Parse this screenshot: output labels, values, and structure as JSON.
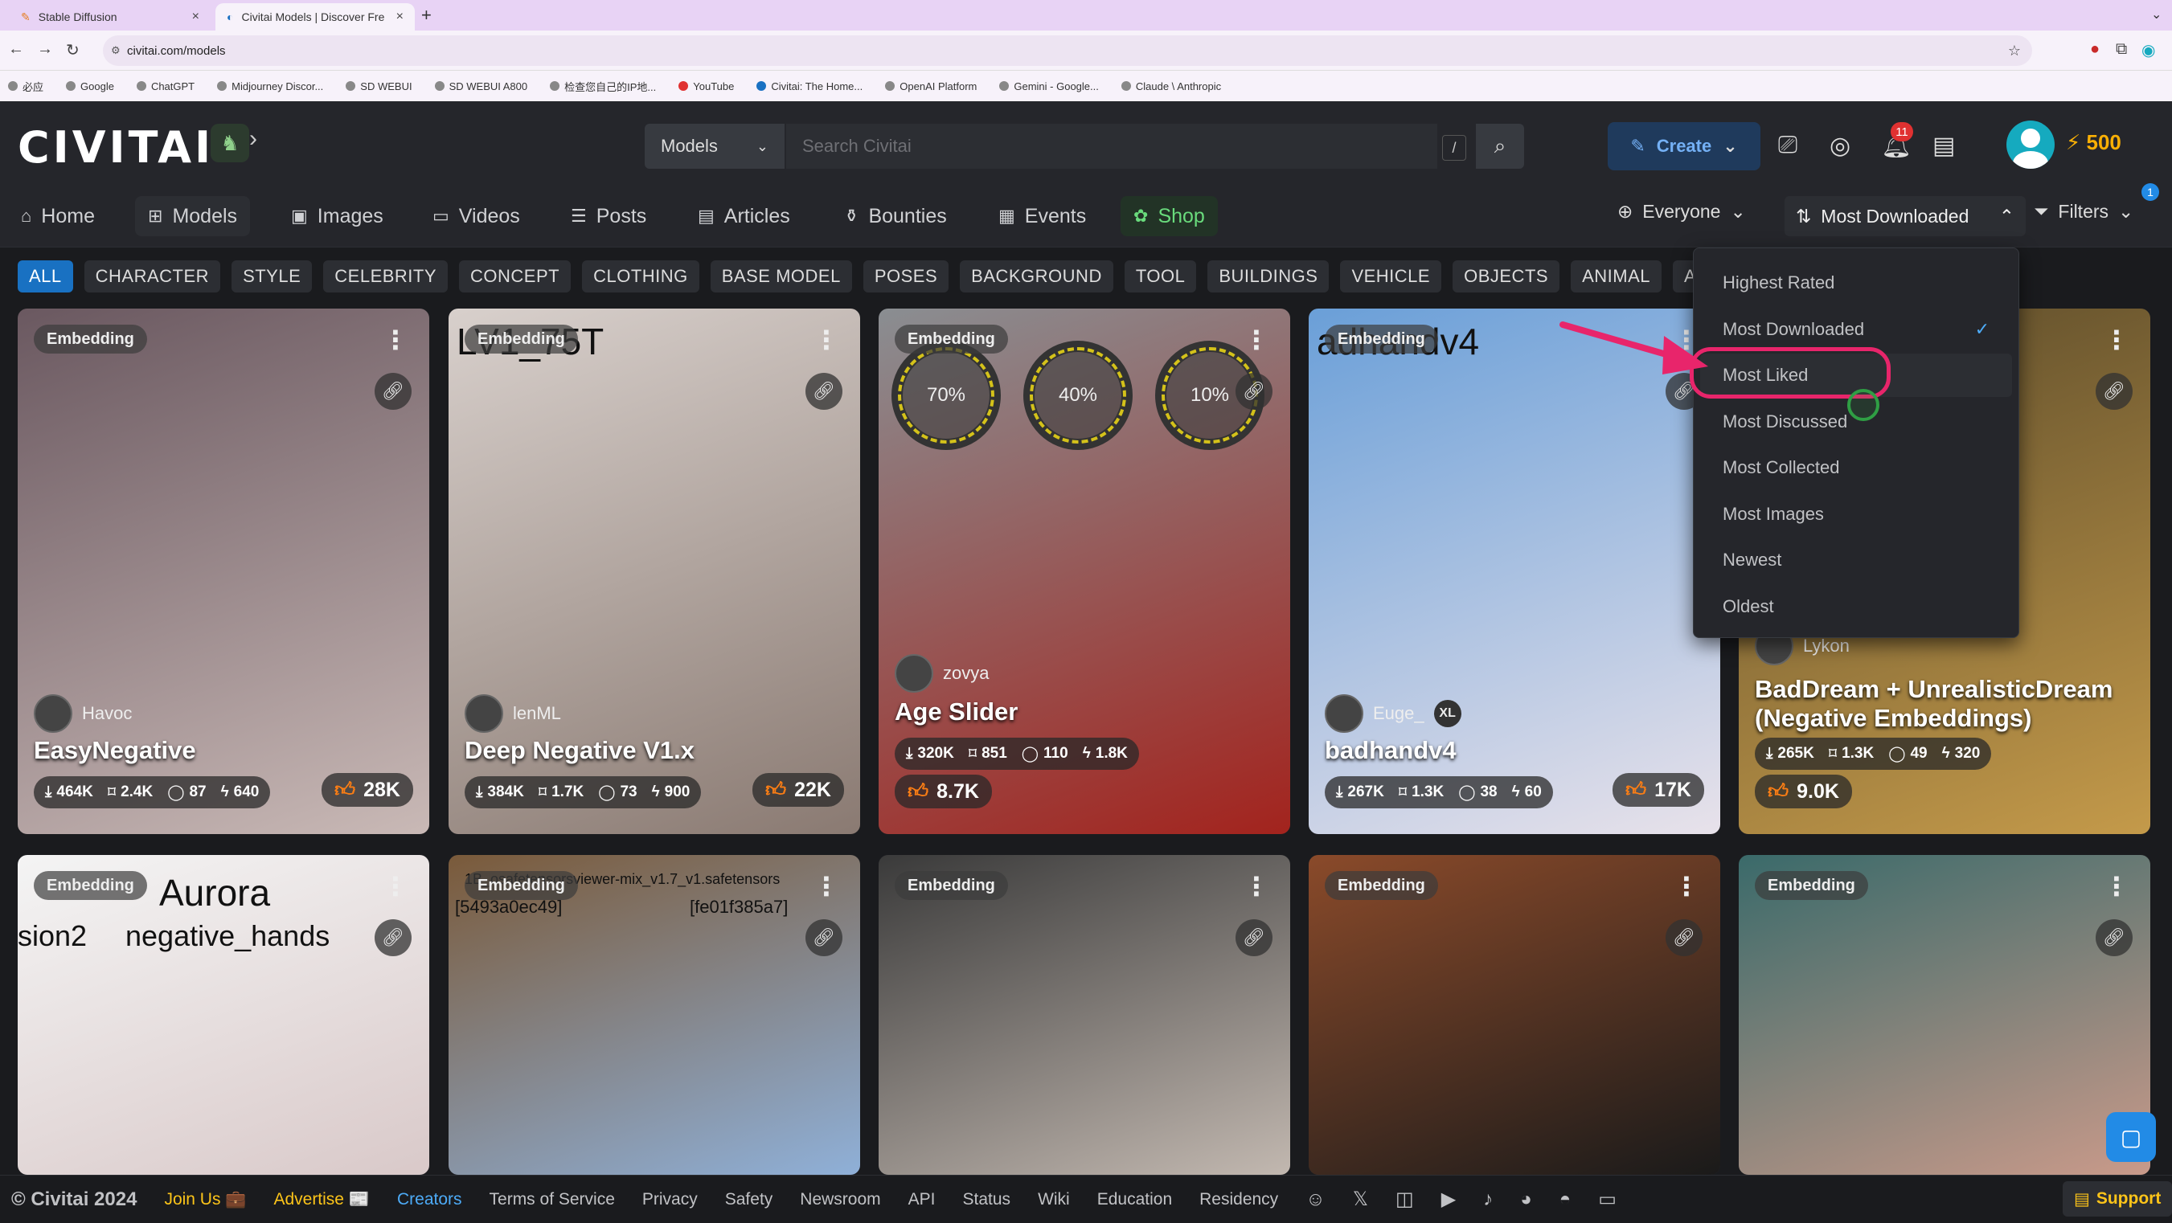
{
  "browser": {
    "tabs": [
      {
        "title": "Stable Diffusion"
      },
      {
        "title": "Civitai Models | Discover Fre"
      }
    ],
    "url": "civitai.com/models",
    "bookmarks": [
      "必应",
      "Google",
      "ChatGPT",
      "Midjourney Discor...",
      "SD WEBUI",
      "SD WEBUI A800",
      "检查您自己的IP地...",
      "YouTube",
      "Civitai: The Home...",
      "OpenAI Platform",
      "Gemini - Google...",
      "Claude \\ Anthropic"
    ]
  },
  "header": {
    "logo": "CIVITAI",
    "search_type": "Models",
    "search_placeholder": "Search Civitai",
    "slash": "/",
    "create_label": "Create",
    "notifications_count": "11",
    "buzz": "500"
  },
  "nav": {
    "items": [
      "Home",
      "Models",
      "Images",
      "Videos",
      "Posts",
      "Articles",
      "Bounties",
      "Events",
      "Shop"
    ],
    "everyone": "Everyone",
    "sort": "Most Downloaded",
    "filters": "Filters",
    "filters_count": "1"
  },
  "categories": [
    "ALL",
    "CHARACTER",
    "STYLE",
    "CELEBRITY",
    "CONCEPT",
    "CLOTHING",
    "BASE MODEL",
    "POSES",
    "BACKGROUND",
    "TOOL",
    "BUILDINGS",
    "VEHICLE",
    "OBJECTS",
    "ANIMAL",
    "ACTIO"
  ],
  "sort_menu": {
    "items": [
      "Highest Rated",
      "Most Downloaded",
      "Most Liked",
      "Most Discussed",
      "Most Collected",
      "Most Images",
      "Newest",
      "Oldest"
    ],
    "selected": "Most Downloaded",
    "highlighted": "Most Liked"
  },
  "cards_row1": [
    {
      "badge": "Embedding",
      "creator": "Havoc",
      "title": "EasyNegative",
      "downloads": "464K",
      "saves": "2.4K",
      "comments": "87",
      "buzz": "640",
      "likes": "28K",
      "colors": [
        "#6a5860",
        "#c9b9b6"
      ]
    },
    {
      "badge": "Embedding",
      "overlay_text": "LV1_75T",
      "creator": "lenML",
      "title": "Deep Negative V1.x",
      "downloads": "384K",
      "saves": "1.7K",
      "comments": "73",
      "buzz": "900",
      "likes": "22K",
      "colors": [
        "#d8d0cc",
        "#8a7a72"
      ]
    },
    {
      "badge": "Embedding",
      "creator": "zovya",
      "title": "Age Slider",
      "downloads": "320K",
      "saves": "851",
      "comments": "110",
      "buzz": "1.8K",
      "likes": "8.7K",
      "rings": [
        "70%",
        "40%",
        "10%"
      ],
      "colors": [
        "#8a8e92",
        "#a3231d"
      ]
    },
    {
      "badge": "Embedding",
      "overlay_text": "adhandv4",
      "creator": "Euge_",
      "creator_tag": "XL",
      "title": "badhandv4",
      "downloads": "267K",
      "saves": "1.3K",
      "comments": "38",
      "buzz": "60",
      "likes": "17K",
      "colors": [
        "#6a9fd8",
        "#e8e2ea"
      ]
    },
    {
      "badge": "Embedding",
      "creator": "Lykon",
      "title": "BadDream + UnrealisticDream (Negative Embeddings)",
      "downloads": "265K",
      "saves": "1.3K",
      "comments": "49",
      "buzz": "320",
      "likes": "9.0K",
      "colors": [
        "#5a4a2a",
        "#c49a4a"
      ]
    }
  ],
  "cards_row2": [
    {
      "badge": "Embedding",
      "overlay_text": "Aurora",
      "overlay_text2": "sion2",
      "overlay_text3": "negative_hands",
      "colors": [
        "#f4f4f4",
        "#d9c9c9"
      ]
    },
    {
      "badge": "Embedding",
      "overlay_text": "1B_o​safetensorsviewer-mix_v1.7_v1.safetensors",
      "overlay_text2": "[5493a0ec49]",
      "overlay_text3": "[fe01f385a7]",
      "colors": [
        "#7a5a3a",
        "#8fb0d8"
      ]
    },
    {
      "badge": "Embedding",
      "colors": [
        "#3a3a3a",
        "#c2b8b0"
      ]
    },
    {
      "badge": "Embedding",
      "colors": [
        "#8a4a2a",
        "#1a1a1a"
      ]
    },
    {
      "badge": "Embedding",
      "colors": [
        "#3a6a6a",
        "#c99a8a"
      ]
    }
  ],
  "footer": {
    "copyright": "© Civitai 2024",
    "links": [
      "Join Us 💼",
      "Advertise 📰",
      "Creators",
      "Terms of Service",
      "Privacy",
      "Safety",
      "Newsroom",
      "API",
      "Status",
      "Wiki",
      "Education",
      "Residency"
    ],
    "support": "Support"
  }
}
